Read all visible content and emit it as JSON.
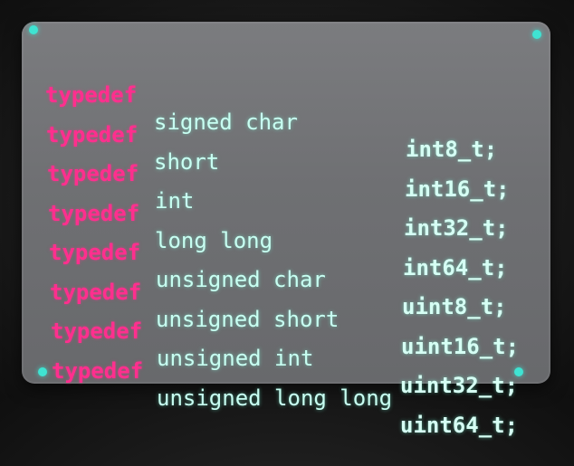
{
  "accent_colors": {
    "keyword": "#ff2f8e",
    "text": "#c8fff2",
    "pin": "#3fe3d2",
    "panel": "#707174"
  },
  "code_lines": [
    {
      "keyword": "typedef",
      "base_type": "signed char",
      "alias": "int8_t;"
    },
    {
      "keyword": "typedef",
      "base_type": "short",
      "alias": "int16_t;"
    },
    {
      "keyword": "typedef",
      "base_type": "int",
      "alias": "int32_t;"
    },
    {
      "keyword": "typedef",
      "base_type": "long long",
      "alias": "int64_t;"
    },
    {
      "keyword": "typedef",
      "base_type": "unsigned char",
      "alias": "uint8_t;"
    },
    {
      "keyword": "typedef",
      "base_type": "unsigned short",
      "alias": "uint16_t;"
    },
    {
      "keyword": "typedef",
      "base_type": "unsigned int",
      "alias": "uint32_t;"
    },
    {
      "keyword": "typedef",
      "base_type": "unsigned long long",
      "alias": "uint64_t;"
    }
  ]
}
